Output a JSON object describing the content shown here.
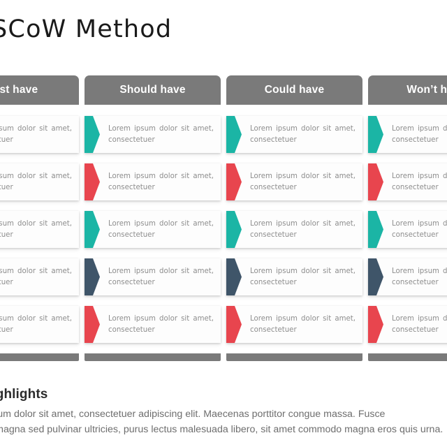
{
  "slide": {
    "title": "MoSCoW Method"
  },
  "colors": {
    "header_gray": "#7a7a7a",
    "teal": "#1bb5a5",
    "red": "#e8454e",
    "navy": "#3f5569",
    "card_bg": "#fdfdfd",
    "body_text": "#8d8d8d",
    "title_text": "#1a1a1a"
  },
  "columns": [
    {
      "header": "Must have",
      "cards": [
        {
          "text": "Lorem ipsum dolor sit amet, consectetuer",
          "accent": "teal"
        },
        {
          "text": "Lorem ipsum dolor sit amet, consectetuer",
          "accent": "red"
        },
        {
          "text": "Lorem ipsum dolor sit amet, consectetuer",
          "accent": "teal"
        },
        {
          "text": "Lorem ipsum dolor sit amet, consectetuer",
          "accent": "navy"
        },
        {
          "text": "Lorem ipsum dolor sit amet, consectetuer",
          "accent": "red"
        }
      ]
    },
    {
      "header": "Should have",
      "cards": [
        {
          "text": "Lorem ipsum dolor sit amet, consectetuer",
          "accent": "teal"
        },
        {
          "text": "Lorem ipsum dolor sit amet, consectetuer",
          "accent": "red"
        },
        {
          "text": "Lorem ipsum dolor sit amet, consectetuer",
          "accent": "teal"
        },
        {
          "text": "Lorem ipsum dolor sit amet, consectetuer",
          "accent": "navy"
        },
        {
          "text": "Lorem ipsum dolor sit amet, consectetuer",
          "accent": "red"
        }
      ]
    },
    {
      "header": "Could have",
      "cards": [
        {
          "text": "Lorem ipsum dolor sit amet, consectetuer",
          "accent": "teal"
        },
        {
          "text": "Lorem ipsum dolor sit amet, consectetuer",
          "accent": "red"
        },
        {
          "text": "Lorem ipsum dolor sit amet, consectetuer",
          "accent": "teal"
        },
        {
          "text": "Lorem ipsum dolor sit amet, consectetuer",
          "accent": "navy"
        },
        {
          "text": "Lorem ipsum dolor sit amet, consectetuer",
          "accent": "red"
        }
      ]
    },
    {
      "header": "Won’t have",
      "cards": [
        {
          "text": "Lorem ipsum dolor sit amet, consectetuer",
          "accent": "teal"
        },
        {
          "text": "Lorem ipsum dolor sit amet, consectetuer",
          "accent": "red"
        },
        {
          "text": "Lorem ipsum dolor sit amet, consectetuer",
          "accent": "teal"
        },
        {
          "text": "Lorem ipsum dolor sit amet, consectetuer",
          "accent": "navy"
        },
        {
          "text": "Lorem ipsum dolor sit amet, consectetuer",
          "accent": "red"
        }
      ]
    }
  ],
  "highlights": {
    "title": "Key Highlights",
    "body": "Lorem ipsum dolor sit amet, consectetuer adipiscing elit. Maecenas porttitor congue massa. Fusce\nposuere, magna sed pulvinar ultricies, purus lectus malesuada libero, sit amet commodo magna eros quis urna."
  }
}
